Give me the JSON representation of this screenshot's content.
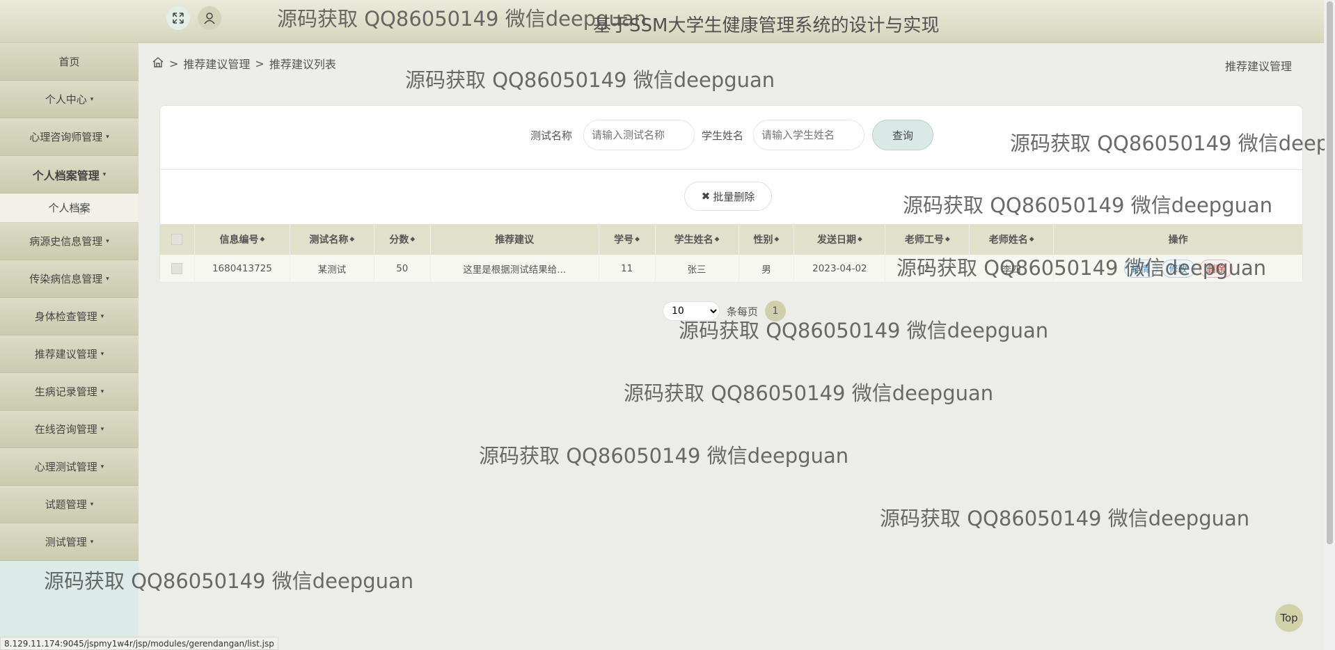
{
  "header": {
    "title": "基于SSM大学生健康管理系统的设计与实现",
    "expand_icon": "expand-icon",
    "user_icon": "user-icon"
  },
  "sidebar": {
    "items": [
      {
        "label": "首页",
        "caret": false
      },
      {
        "label": "个人中心",
        "caret": true
      },
      {
        "label": "心理咨询师管理",
        "caret": true
      },
      {
        "label": "个人档案管理",
        "caret": true,
        "expanded": true
      },
      {
        "label": "病源史信息管理",
        "caret": true
      },
      {
        "label": "传染病信息管理",
        "caret": true
      },
      {
        "label": "身体检查管理",
        "caret": true
      },
      {
        "label": "推荐建议管理",
        "caret": true
      },
      {
        "label": "生病记录管理",
        "caret": true
      },
      {
        "label": "在线咨询管理",
        "caret": true
      },
      {
        "label": "心理测试管理",
        "caret": true
      },
      {
        "label": "试题管理",
        "caret": true
      },
      {
        "label": "测试管理",
        "caret": true
      }
    ],
    "subitem": "个人档案"
  },
  "breadcrumb": {
    "home_icon": "home-icon",
    "level1": "推荐建议管理",
    "level2": "推荐建议列表",
    "separator": ">",
    "right_title": "推荐建议管理"
  },
  "search": {
    "test_name_label": "测试名称",
    "test_name_placeholder": "请输入测试名称",
    "student_name_label": "学生姓名",
    "student_name_placeholder": "请输入学生姓名",
    "query_button": "查询"
  },
  "actions": {
    "bulk_delete": "批量删除"
  },
  "table": {
    "columns": [
      "信息编号",
      "测试名称",
      "分数",
      "推荐建议",
      "学号",
      "学生姓名",
      "性别",
      "发送日期",
      "老师工号",
      "老师姓名",
      "操作"
    ],
    "rows": [
      {
        "id": "1680413725",
        "test_name": "某测试",
        "score": "50",
        "advice": "这里是根据测试结果给...",
        "student_no": "11",
        "student_name": "张三",
        "gender": "男",
        "date": "2023-04-02",
        "teacher_no": "2",
        "teacher_name": "李四",
        "ops": [
          "详情",
          "修改",
          "删除"
        ]
      }
    ]
  },
  "pagination": {
    "page_size": "10",
    "per_page_label": "条每页",
    "current_page": "1"
  },
  "watermark": "源码获取 QQ86050149 微信deepguan",
  "top_button": "Top",
  "status_url": "8.129.11.174:9045/jspmy1w4r/jsp/modules/gerendangan/list.jsp"
}
